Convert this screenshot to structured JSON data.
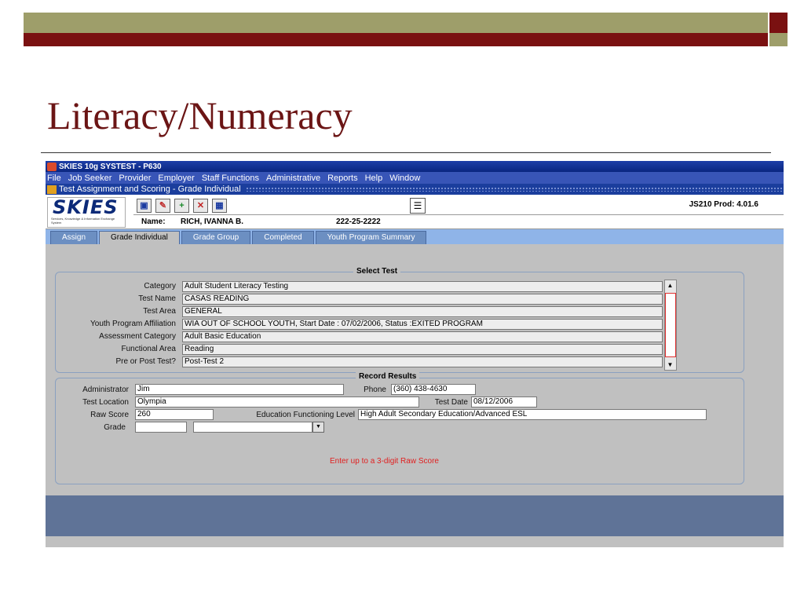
{
  "slide": {
    "title": "Literacy/Numeracy"
  },
  "app": {
    "window_title": "SKIES 10g SYSTEST - P630",
    "menu": [
      "File",
      "Job Seeker",
      "Provider",
      "Employer",
      "Staff Functions",
      "Administrative",
      "Reports",
      "Help",
      "Window"
    ],
    "form_title": "Test Assignment and Scoring - Grade Individual",
    "logo_text": "SKIES",
    "logo_sub": "Services, Knowledge & Information Exchange System",
    "version": "JS210 Prod: 4.01.6",
    "name_label": "Name:",
    "name_value": "RICH, IVANNA B.",
    "ssn": "222-25-2222",
    "tabs": [
      "Assign",
      "Grade Individual",
      "Grade Group",
      "Completed",
      "Youth Program Summary"
    ],
    "active_tab": "Grade Individual",
    "toolbar_icons": [
      "book-icon",
      "pen-icon",
      "add-icon",
      "delete-icon",
      "save-icon",
      "notes-icon"
    ]
  },
  "select_test": {
    "legend": "Select Test",
    "category": {
      "label": "Category",
      "value": "Adult Student Literacy Testing"
    },
    "test_name": {
      "label": "Test Name",
      "value": "CASAS READING"
    },
    "test_area": {
      "label": "Test Area",
      "value": "GENERAL"
    },
    "youth_affiliation": {
      "label": "Youth Program Affiliation",
      "value": "WIA OUT OF SCHOOL YOUTH, Start Date : 07/02/2006, Status :EXITED PROGRAM"
    },
    "assessment_category": {
      "label": "Assessment Category",
      "value": "Adult Basic Education"
    },
    "functional_area": {
      "label": "Functional Area",
      "value": "Reading"
    },
    "pre_post": {
      "label": "Pre or Post Test?",
      "value": "Post-Test 2"
    }
  },
  "record_results": {
    "legend": "Record Results",
    "administrator": {
      "label": "Administrator",
      "value": "Jim"
    },
    "phone": {
      "label": "Phone",
      "value": "(360) 438-4630"
    },
    "test_location": {
      "label": "Test Location",
      "value": "Olympia"
    },
    "test_date": {
      "label": "Test Date",
      "value": "08/12/2006"
    },
    "raw_score": {
      "label": "Raw Score",
      "value": "260"
    },
    "efl": {
      "label": "Education Functioning Level",
      "value": "High Adult Secondary Education/Advanced ESL"
    },
    "grade": {
      "label": "Grade",
      "value": "",
      "select_value": ""
    },
    "message": "Enter up to a 3-digit Raw Score"
  }
}
